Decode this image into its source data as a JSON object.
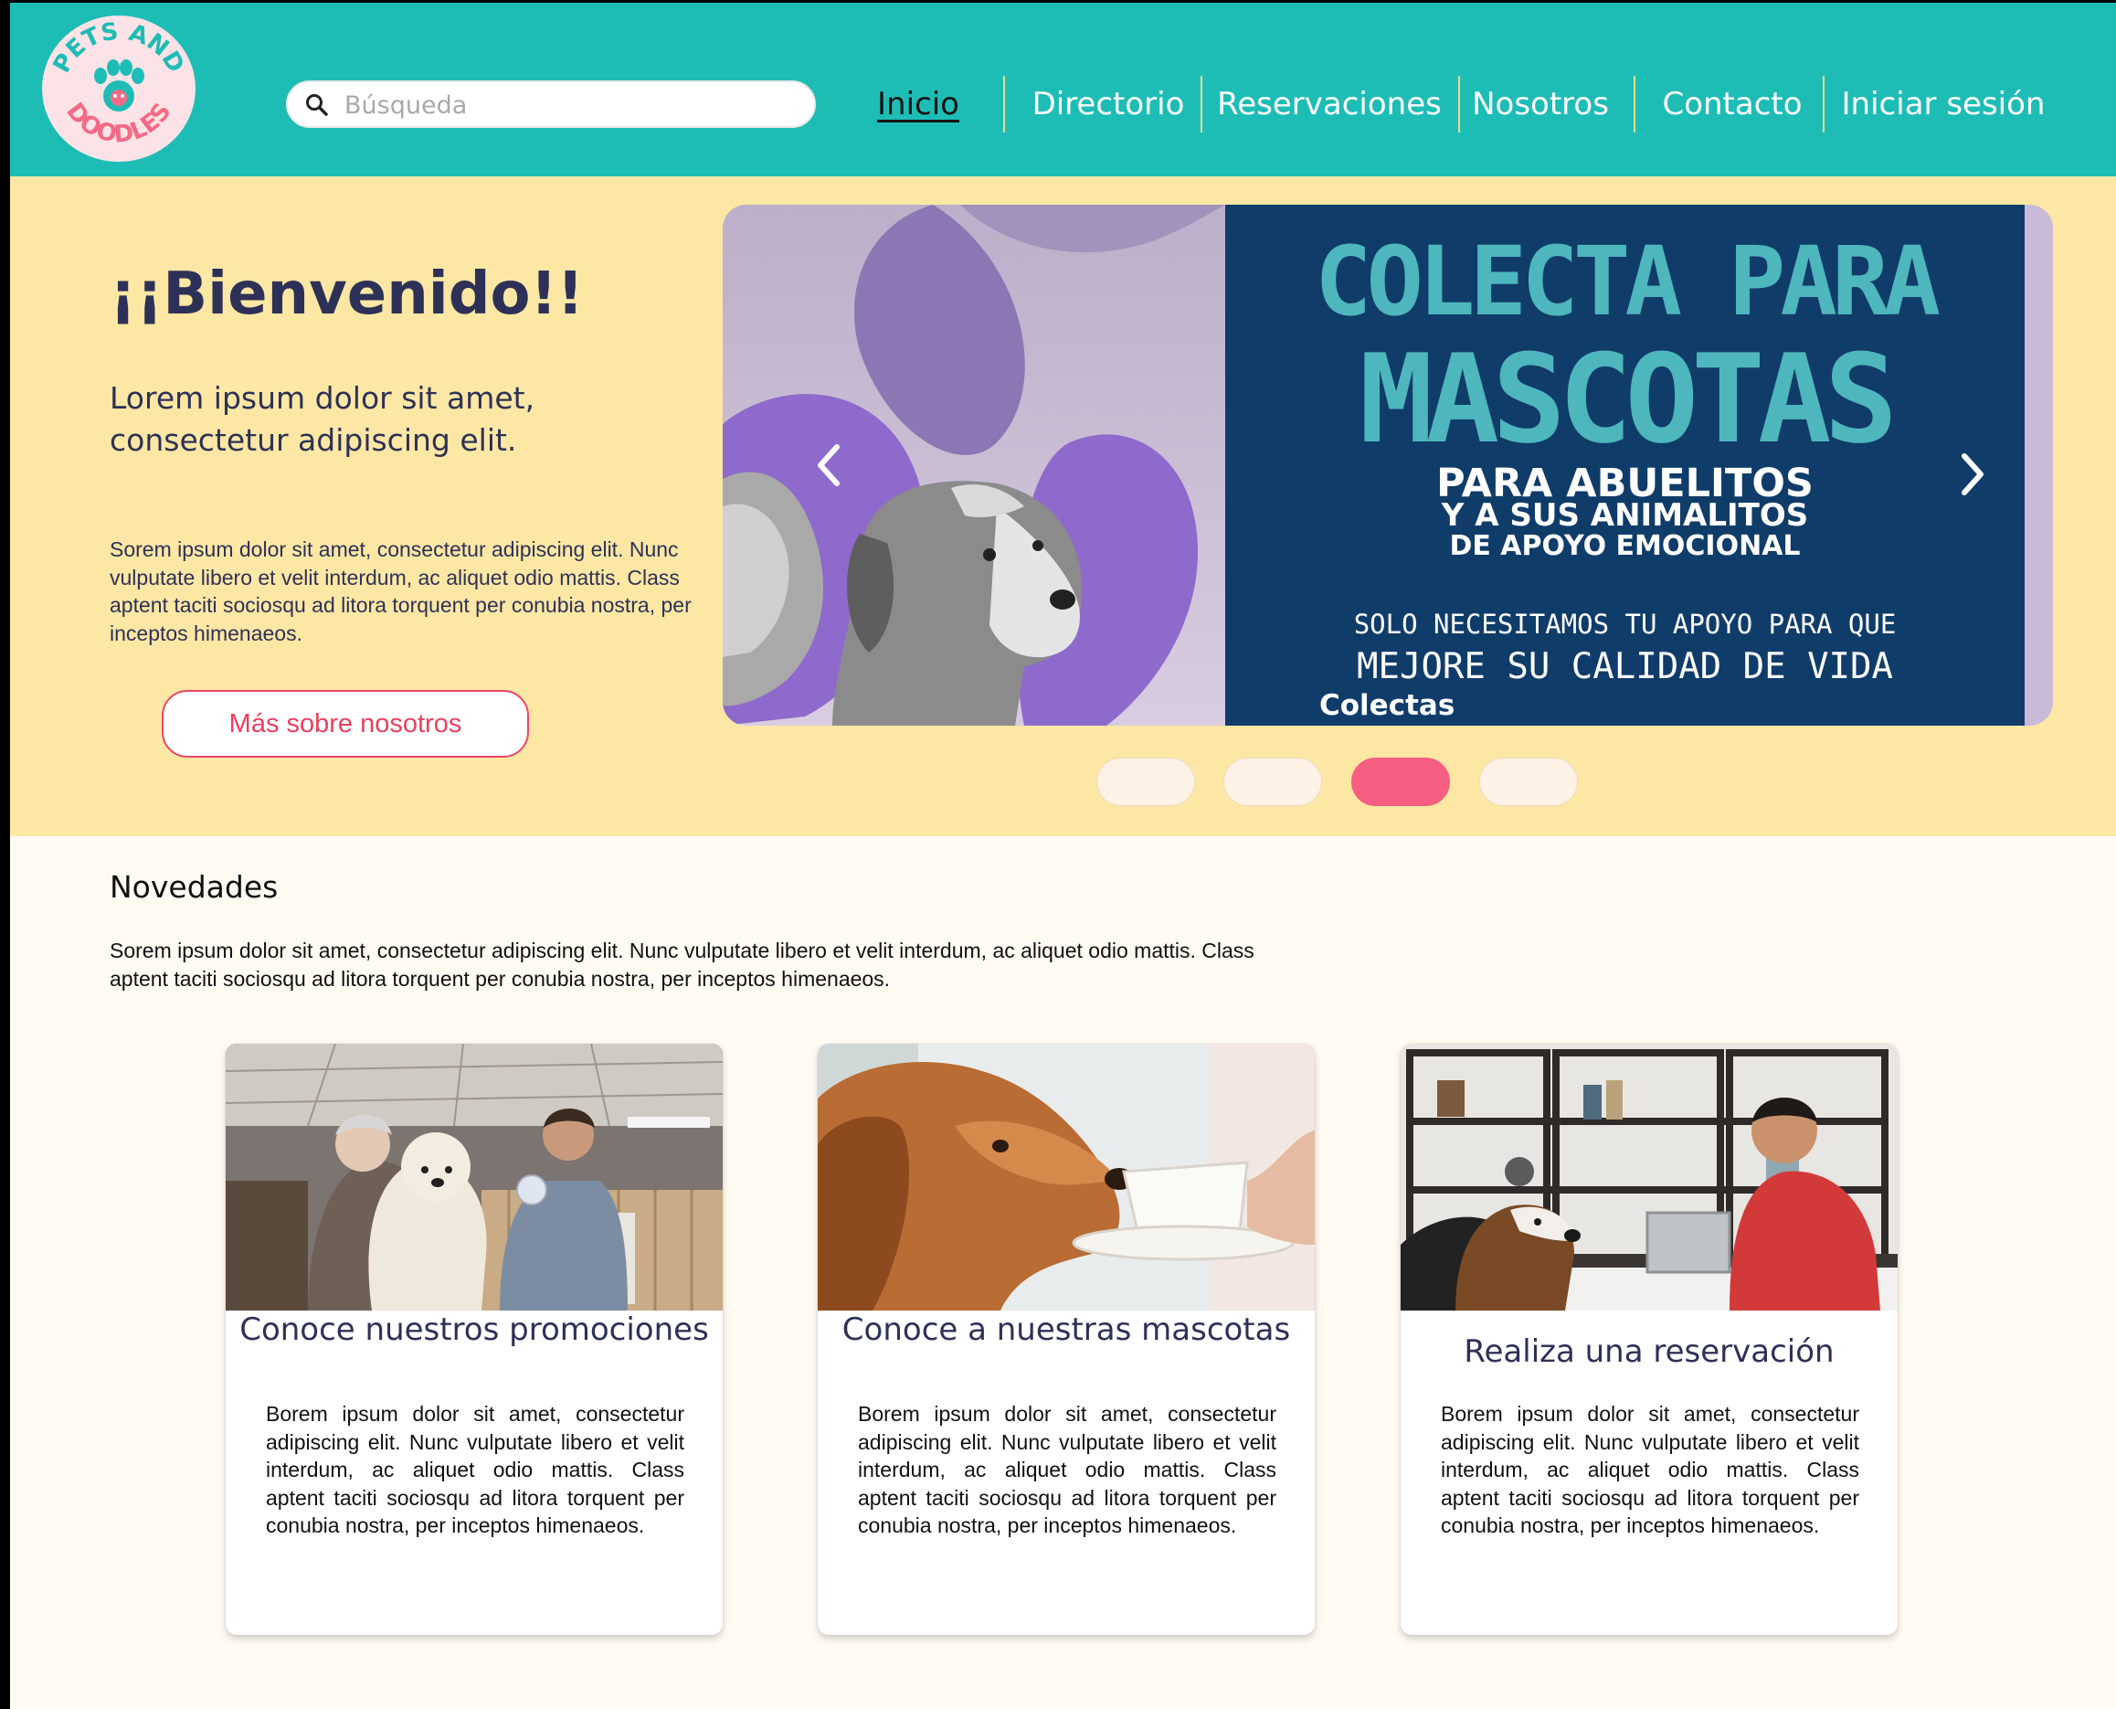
{
  "header": {
    "logo_text": "PETS AND DOODLES",
    "search": {
      "placeholder": "Búsqueda",
      "value": ""
    },
    "nav": [
      {
        "label": "Inicio",
        "active": true
      },
      {
        "label": "Directorio",
        "active": false
      },
      {
        "label": "Reservaciones",
        "active": false
      },
      {
        "label": "Nosotros",
        "active": false
      },
      {
        "label": "Contacto",
        "active": false
      },
      {
        "label": "Iniciar sesión",
        "active": false
      }
    ]
  },
  "hero": {
    "title": "¡¡Bienvenido!!",
    "subtitle": "Lorem ipsum dolor sit amet, consectetur adipiscing elit.",
    "text": "Sorem ipsum dolor sit amet, consectetur adipiscing elit. Nunc vulputate libero et velit interdum, ac aliquet odio mattis. Class aptent taciti sociosqu ad litora torquent per conubia nostra, per inceptos himenaeos.",
    "button_label": "Más sobre nosotros"
  },
  "carousel": {
    "slide": {
      "line1": "COLECTA PARA",
      "line2": "MASCOTAS",
      "line3": "PARA ABUELITOS",
      "line4": "Y A SUS ANIMALITOS",
      "line5": "DE APOYO EMOCIONAL",
      "line6": "SOLO NECESITAMOS TU APOYO PARA QUE",
      "line7": "MEJORE SU CALIDAD DE VIDA"
    },
    "caption": "Colectas",
    "prev_icon": "chevron-left-icon",
    "next_icon": "chevron-right-icon",
    "active_index": 2,
    "slide_count": 4
  },
  "news": {
    "title": "Novedades",
    "text": "Sorem ipsum dolor sit amet, consectetur adipiscing elit. Nunc vulputate libero et velit interdum, ac aliquet odio mattis. Class aptent taciti sociosqu ad litora torquent per conubia nostra, per inceptos himenaeos.",
    "cards": [
      {
        "title": "Conoce nuestros promociones",
        "text": "Borem ipsum dolor sit amet, consectetur adipiscing elit. Nunc vulputate libero et velit interdum, ac aliquet odio mattis. Class aptent taciti sociosqu ad litora torquent per conubia nostra, per inceptos himenaeos."
      },
      {
        "title": "Conoce a nuestras mascotas",
        "text": "Borem ipsum dolor sit amet, consectetur adipiscing elit. Nunc vulputate libero et velit interdum, ac aliquet odio mattis. Class aptent taciti sociosqu ad litora torquent per conubia nostra, per inceptos himenaeos."
      },
      {
        "title": "Realiza una reservación",
        "text": "Borem ipsum dolor sit amet, consectetur adipiscing elit. Nunc vulputate libero et velit interdum, ac aliquet odio mattis. Class aptent taciti sociosqu ad litora torquent per conubia nostra, per inceptos himenaeos."
      }
    ]
  },
  "colors": {
    "header_bg": "#1DBDB6",
    "hero_bg": "#FDE7A4",
    "page_bg": "#FFFBF3",
    "accent_pink": "#F65E82",
    "text_navy": "#2E3157"
  }
}
